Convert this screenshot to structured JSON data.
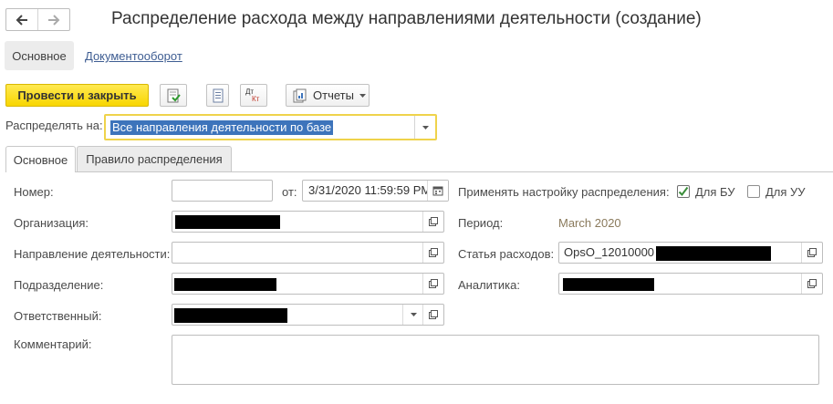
{
  "window": {
    "title": "Распределение расхода между направлениями деятельности (создание)"
  },
  "nav": {
    "back_icon": "arrow-left-icon",
    "forward_icon": "arrow-right-icon"
  },
  "top_tabs": {
    "main": "Основное",
    "docflow": "Документооборот"
  },
  "toolbar": {
    "post_and_close": "Провести и закрыть",
    "reports": "Отчеты",
    "icons": [
      "post-document-icon",
      "list-icon",
      "dt-kt-icon",
      "reports-icon",
      "chevron-down-icon"
    ],
    "dt": "Дт",
    "kt": "Кт"
  },
  "distribute": {
    "label": "Распределять на:",
    "value": "Все направления деятельности по базе"
  },
  "inner_tabs": {
    "main": "Основное",
    "rule": "Правило распределения"
  },
  "form": {
    "number_label": "Номер:",
    "number_value": "",
    "date_from_label": "от:",
    "date_value": "3/31/2020 11:59:59 PM",
    "organization_label": "Организация:",
    "activity_direction_label": "Направление деятельности:",
    "activity_direction_value": "",
    "department_label": "Подразделение:",
    "responsible_label": "Ответственный:",
    "comment_label": "Комментарий:",
    "comment_value": "",
    "apply_setting_label": "Применять настройку распределения:",
    "for_bu_label": "Для БУ",
    "for_bu_checked": true,
    "for_uu_label": "Для УУ",
    "for_uu_checked": false,
    "period_label": "Период:",
    "period_value": "March 2020",
    "expense_item_label": "Статья расходов:",
    "expense_item_value": "OpsO_12010000",
    "analytics_label": "Аналитика:"
  },
  "colors": {
    "accent_yellow": "#f8d600",
    "selection_blue": "#3d74bb",
    "link_blue": "#3e5d92",
    "checkbox_green": "#3a8d3a"
  }
}
